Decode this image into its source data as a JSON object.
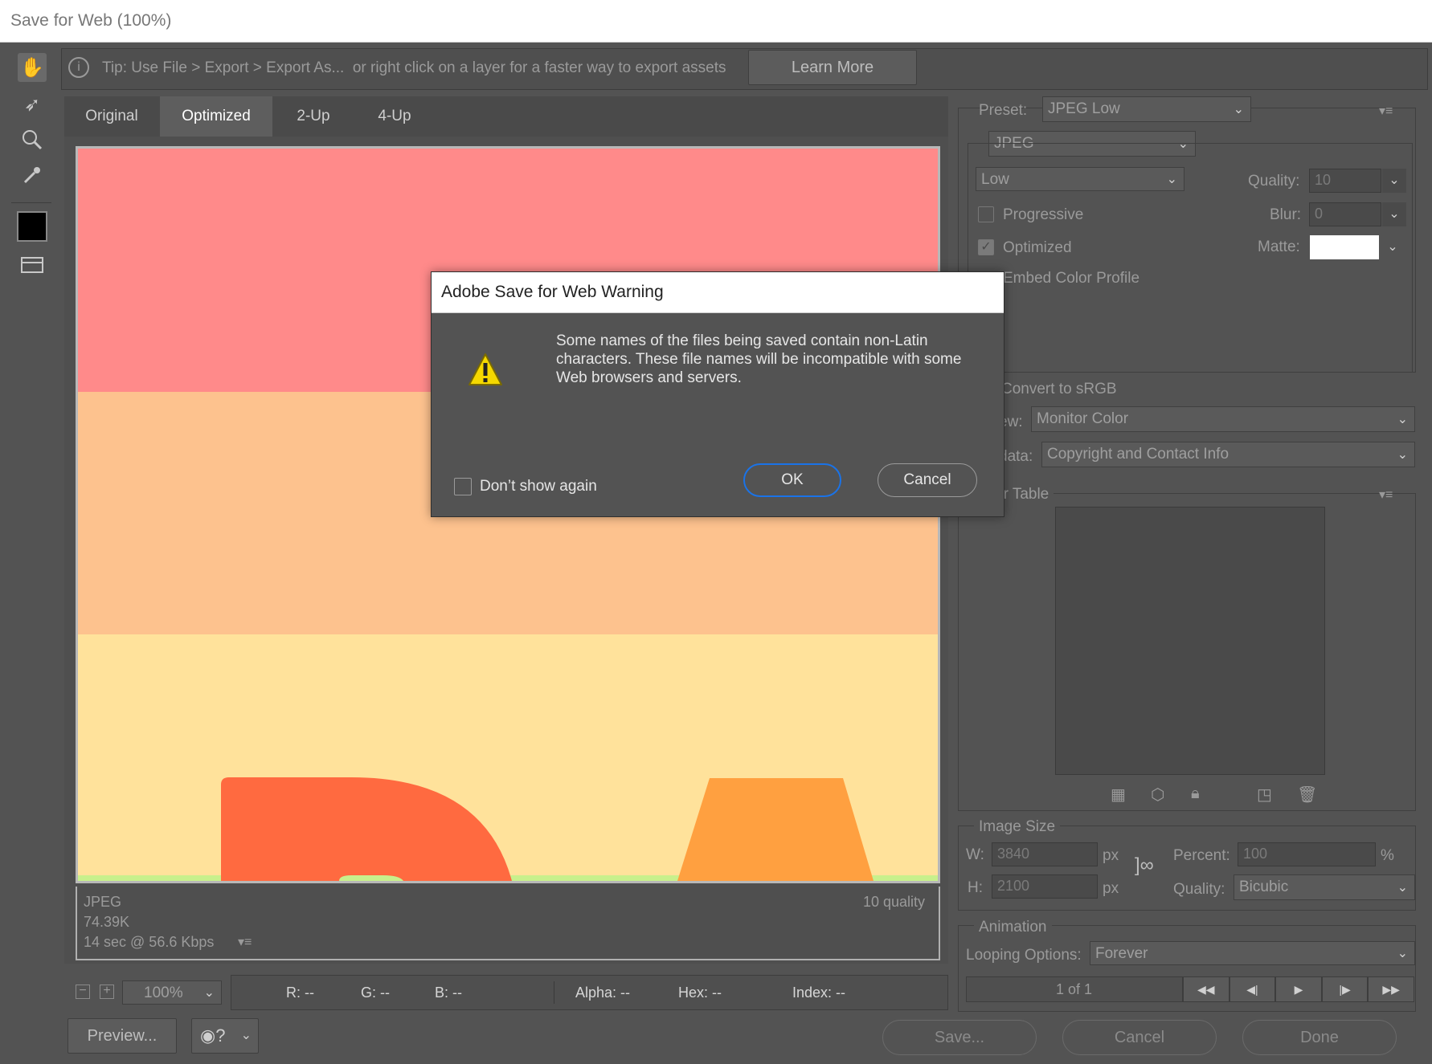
{
  "window": {
    "title": "Save for Web (100%)"
  },
  "tip": {
    "text": "Tip: Use File > Export > Export As...  or right click on a layer for a faster way to export assets",
    "learn_more": "Learn More"
  },
  "view_tabs": [
    "Original",
    "Optimized",
    "2-Up",
    "4-Up"
  ],
  "preview_info": {
    "format": "JPEG",
    "size": "74.39K",
    "time": "14 sec @ 56.6 Kbps",
    "quality": "10 quality"
  },
  "zoom": {
    "value": "100%"
  },
  "readout": {
    "r": "R: --",
    "g": "G: --",
    "b": "B: --",
    "alpha": "Alpha: --",
    "hex": "Hex: --",
    "index": "Index: --"
  },
  "bottom_buttons": {
    "preview": "Preview...",
    "save": "Save...",
    "cancel": "Cancel",
    "done": "Done"
  },
  "settings": {
    "preset_label": "Preset:",
    "preset_value": "JPEG Low",
    "format": "JPEG",
    "compression": "Low",
    "quality_label": "Quality:",
    "quality_value": "10",
    "progressive": "Progressive",
    "blur_label": "Blur:",
    "blur_value": "0",
    "optimized": "Optimized",
    "matte_label": "Matte:",
    "embed": "Embed Color Profile",
    "convert": "Convert to sRGB",
    "preview_label": "ew:",
    "preview_value": "Monitor Color",
    "metadata_label": "data:",
    "metadata_value": "Copyright and Contact Info",
    "color_table": "or Table"
  },
  "image_size": {
    "title": "Image Size",
    "w_label": "W:",
    "w_value": "3840",
    "h_label": "H:",
    "h_value": "2100",
    "px": "px",
    "percent_label": "Percent:",
    "percent_value": "100",
    "percent_unit": "%",
    "quality_label": "Quality:",
    "quality_value": "Bicubic"
  },
  "animation": {
    "title": "Animation",
    "looping_label": "Looping Options:",
    "looping_value": "Forever",
    "frame": "1 of 1"
  },
  "dialog": {
    "title": "Adobe Save for Web Warning",
    "message": "Some names of the files being saved contain non-Latin characters. These file names will be incompatible with some Web browsers and servers.",
    "dont_show": "Don’t show again",
    "ok": "OK",
    "cancel": "Cancel"
  },
  "colors": {
    "band1": "#ff8a8a",
    "band2": "#fdc28e",
    "band3": "#ffe29b",
    "letter1": "#ff6a40",
    "letter2": "#ffa040",
    "green": "#c8f08c",
    "accent": "#1a73e8"
  }
}
